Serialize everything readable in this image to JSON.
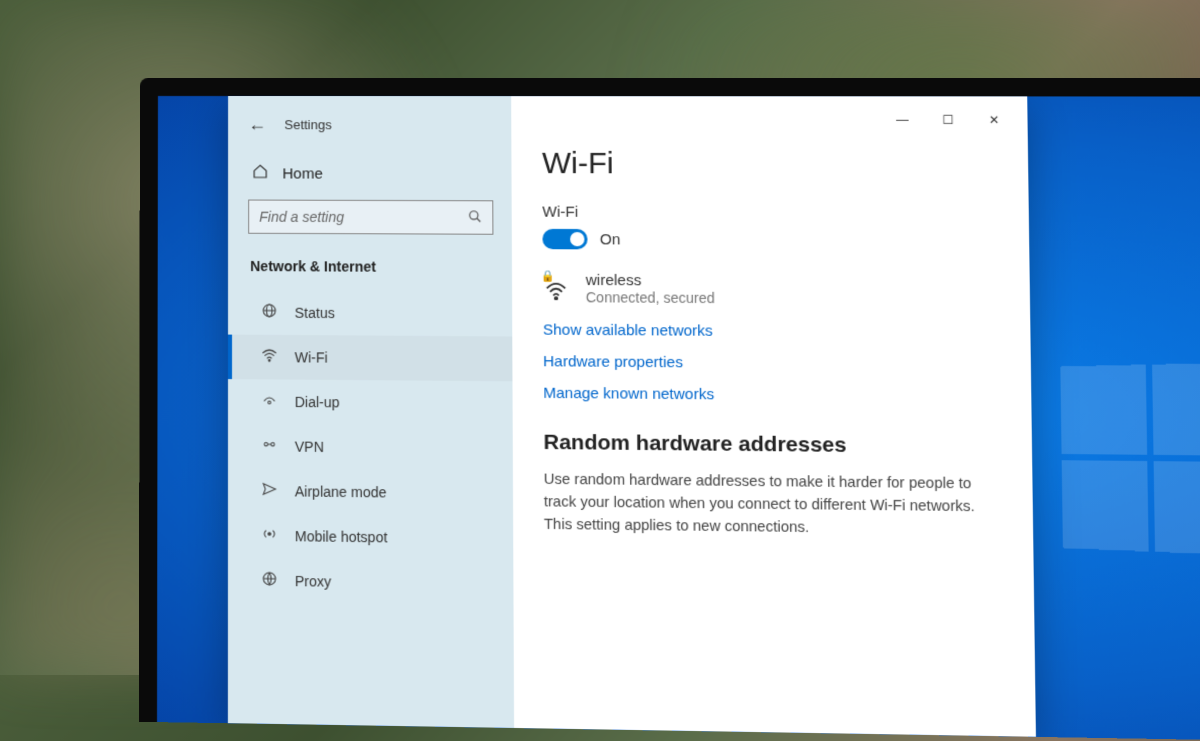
{
  "window": {
    "title": "Settings",
    "controls": {
      "min": "—",
      "max": "☐",
      "close": "✕"
    }
  },
  "sidebar": {
    "home": "Home",
    "search_placeholder": "Find a setting",
    "category": "Network & Internet",
    "items": [
      {
        "label": "Status",
        "icon": "status"
      },
      {
        "label": "Wi-Fi",
        "icon": "wifi",
        "active": true
      },
      {
        "label": "Dial-up",
        "icon": "dialup"
      },
      {
        "label": "VPN",
        "icon": "vpn"
      },
      {
        "label": "Airplane mode",
        "icon": "airplane"
      },
      {
        "label": "Mobile hotspot",
        "icon": "hotspot"
      },
      {
        "label": "Proxy",
        "icon": "proxy"
      }
    ]
  },
  "content": {
    "title": "Wi-Fi",
    "toggle_section_label": "Wi-Fi",
    "toggle_state": "On",
    "network": {
      "name": "wireless",
      "status": "Connected, secured"
    },
    "links": [
      "Show available networks",
      "Hardware properties",
      "Manage known networks"
    ],
    "section2": {
      "heading": "Random hardware addresses",
      "body": "Use random hardware addresses to make it harder for people to track your location when you connect to different Wi-Fi networks. This setting applies to new connections."
    }
  }
}
